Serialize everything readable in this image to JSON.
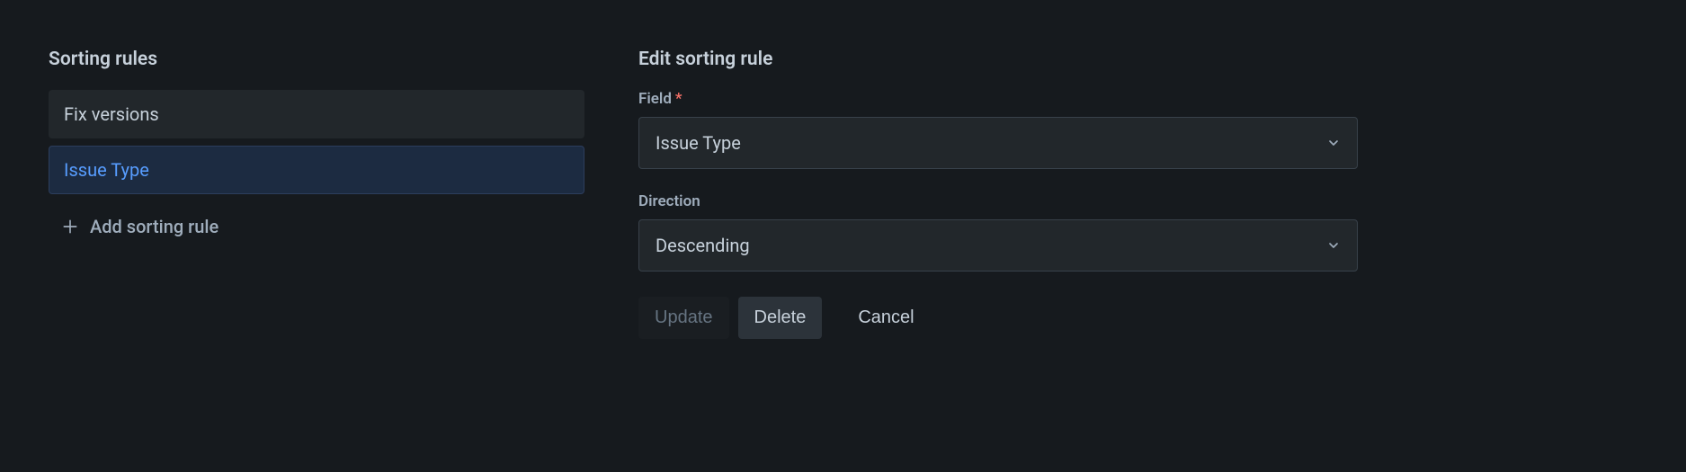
{
  "left": {
    "title": "Sorting rules",
    "rules": [
      {
        "label": "Fix versions"
      },
      {
        "label": "Issue Type"
      }
    ],
    "addLabel": "Add sorting rule"
  },
  "right": {
    "title": "Edit sorting rule",
    "fieldLabel": "Field",
    "fieldValue": "Issue Type",
    "directionLabel": "Direction",
    "directionValue": "Descending",
    "updateLabel": "Update",
    "deleteLabel": "Delete",
    "cancelLabel": "Cancel"
  }
}
